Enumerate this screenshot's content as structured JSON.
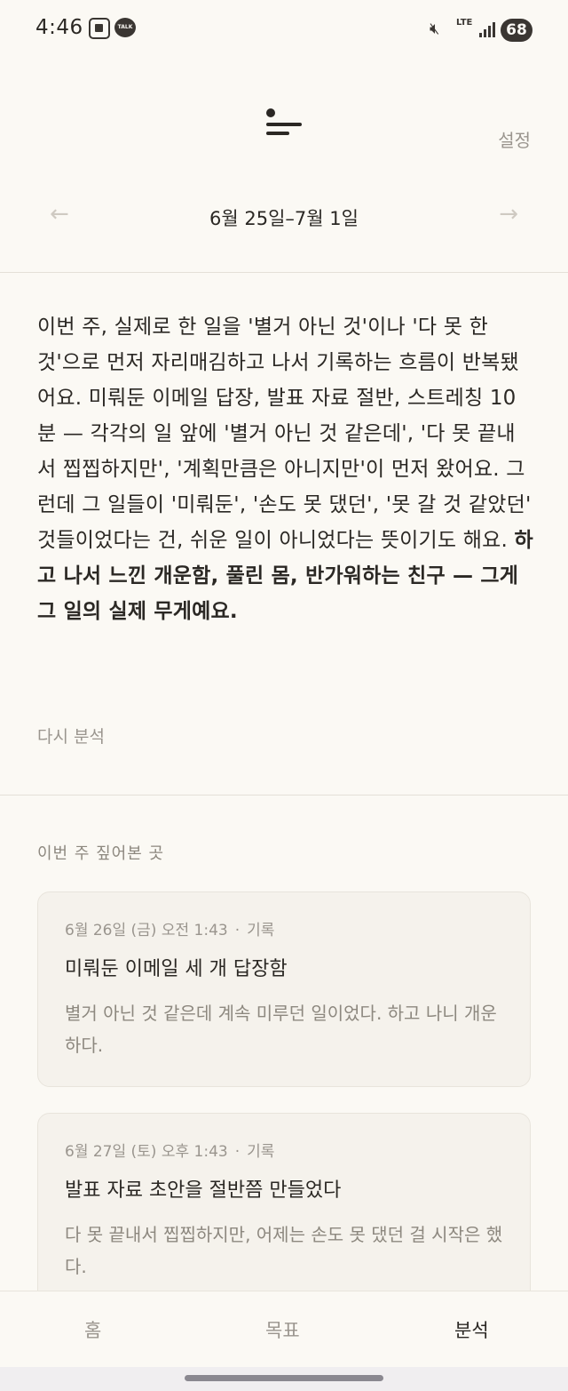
{
  "status_bar": {
    "time": "4:46",
    "talk_icon_text": "TALK",
    "network": "LTE",
    "battery": "68"
  },
  "header": {
    "settings_label": "설정",
    "week_label": "6월 25일–7월 1일",
    "prev_arrow": "←",
    "next_arrow": "→"
  },
  "summary": {
    "text": "이번 주, 실제로 한 일을 '별거 아닌 것'이나 '다 못 한 것'으로 먼저 자리매김하고 나서 기록하는 흐름이 반복됐어요. 미뤄둔 이메일 답장, 발표 자료 절반, 스트레칭 10분 — 각각의 일 앞에 '별거 아닌 것 같은데', '다 못 끝내서 찝찝하지만', '계획만큼은 아니지만'이 먼저 왔어요. 그런데 그 일들이 '미뤄둔', '손도 못 댔던', '못 갈 것 같았던' 것들이었다는 건, 쉬운 일이 아니었다는 뜻이기도 해요. ",
    "emphasis": "하고 나서 느낀 개운함, 풀린 몸, 반가워하는 친구 — 그게 그 일의 실제 무게예요.",
    "reanalyze_label": "다시 분석"
  },
  "section": {
    "title": "이번 주 짚어본 곳"
  },
  "entries": [
    {
      "date": "6월 26일 (금) 오전 1:43",
      "separator": "·",
      "type": "기록",
      "title": "미뤄둔 이메일 세 개 답장함",
      "body": "별거 아닌 것 같은데 계속 미루던 일이었다. 하고 나니 개운하다."
    },
    {
      "date": "6월 27일 (토) 오후 1:43",
      "separator": "·",
      "type": "기록",
      "title": "발표 자료 초안을 절반쯤 만들었다",
      "body": "다 못 끝내서 찝찝하지만, 어제는 손도 못 댔던 걸 시작은 했다."
    }
  ],
  "bottom_nav": {
    "items": [
      "홈",
      "목표",
      "분석"
    ],
    "active": "분석"
  }
}
